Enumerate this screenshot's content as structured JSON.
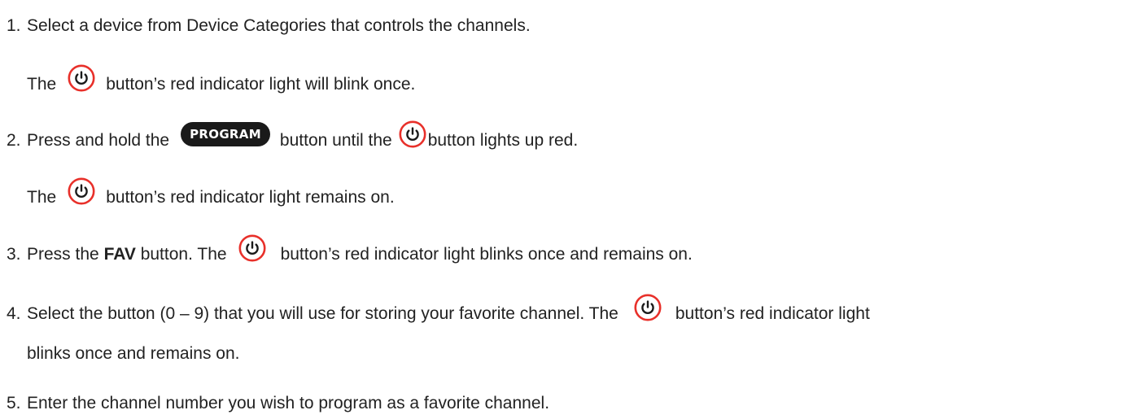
{
  "accent_color": "#e8302a",
  "icons": {
    "power": "power-icon",
    "program_badge": "PROGRAM"
  },
  "steps": [
    {
      "number": "1.",
      "text": "Select a device from Device Categories that controls the channels."
    },
    {
      "note_prefix": "The",
      "note_suffix": "button’s red indicator light will blink once."
    },
    {
      "number": "2.",
      "text_a": "Press and hold the",
      "text_b": "button until the",
      "text_c": "button lights up red."
    },
    {
      "note_prefix": "The",
      "note_suffix": "button’s red indicator light remains on."
    },
    {
      "number": "3.",
      "text_a": "Press the",
      "bold": "FAV",
      "text_b": "button. The",
      "text_c": "button’s red indicator light blinks once and remains on."
    },
    {
      "number": "4.",
      "text_a": "Select the button (0 – 9) that you will use for storing your favorite channel. The",
      "text_b": "button’s red indicator light",
      "text_c": "blinks once and remains on."
    },
    {
      "number": "5.",
      "text": "Enter the channel number you wish to program as a favorite channel."
    }
  ]
}
